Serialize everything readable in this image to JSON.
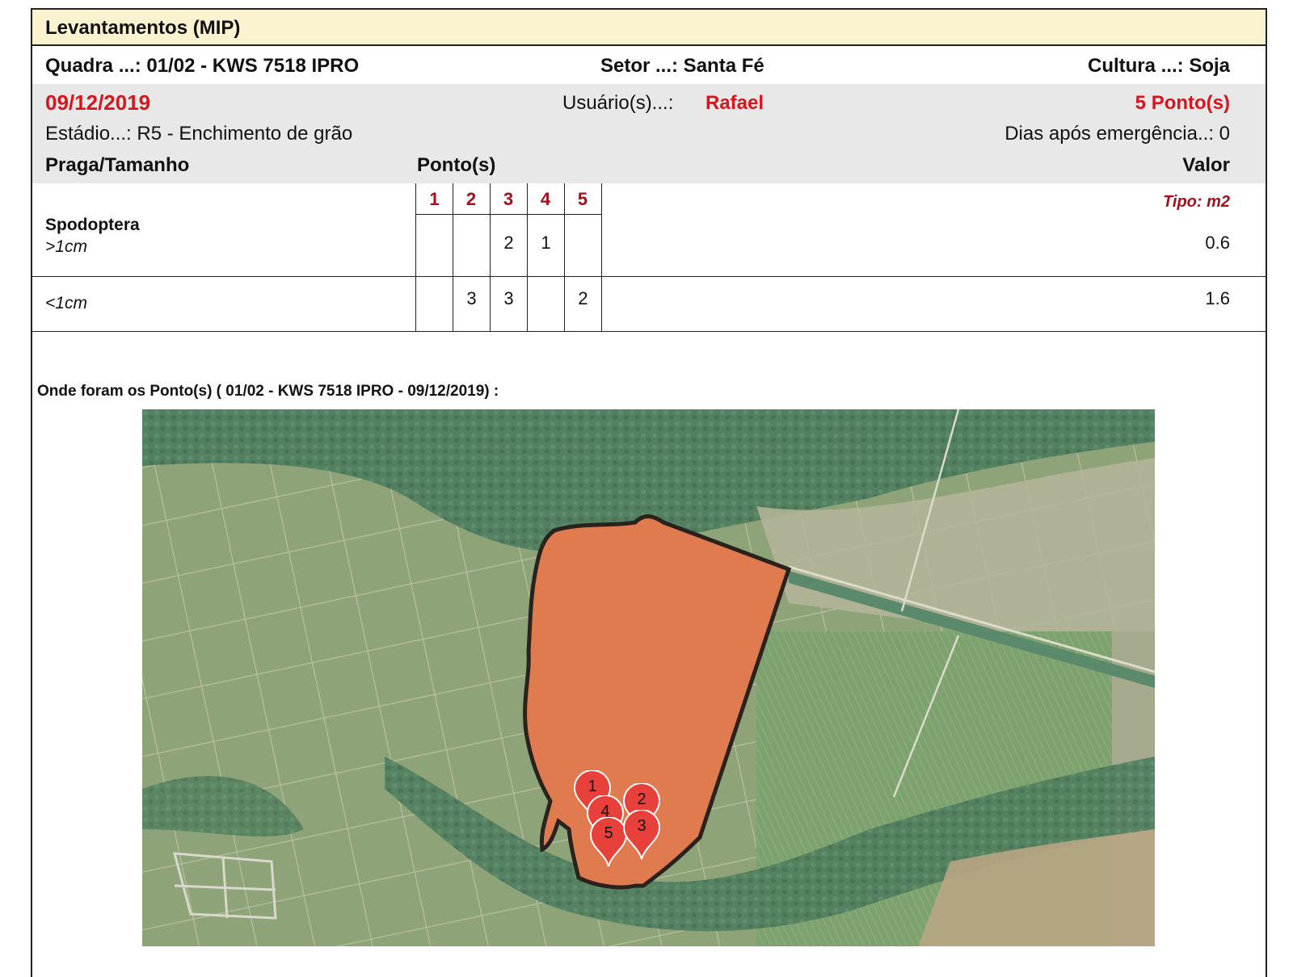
{
  "report": {
    "title": "Levantamentos (MIP)",
    "quadra": "Quadra ...: 01/02  - KWS 7518 IPRO",
    "setor": "Setor ...: Santa Fé",
    "cultura": "Cultura ...: Soja",
    "date": "09/12/2019",
    "usuarios_label": "Usuário(s)...:",
    "usuario": "Rafael",
    "pontos_count": "5 Ponto(s)",
    "estadio": "Estádio...: R5 - Enchimento de grão",
    "dias": "Dias após emergência..: 0"
  },
  "table": {
    "col_praga": "Praga/Tamanho",
    "col_pontos": "Ponto(s)",
    "col_valor": "Valor",
    "point_headers": [
      "1",
      "2",
      "3",
      "4",
      "5"
    ],
    "tipo": "Tipo: m2",
    "rows": [
      {
        "praga": "Spodoptera",
        "tamanho": ">1cm",
        "cells": [
          "",
          "",
          "2",
          "1",
          ""
        ],
        "valor": "0.6"
      },
      {
        "praga": "",
        "tamanho": "<1cm",
        "cells": [
          "",
          "3",
          "3",
          "",
          "2"
        ],
        "valor": "1.6"
      }
    ]
  },
  "map": {
    "caption": "Onde foram os Ponto(s) ( 01/02  - KWS 7518 IPRO - 09/12/2019) :",
    "markers": [
      "1",
      "2",
      "4",
      "5",
      "3"
    ],
    "colors": {
      "field_fill": "#e07a4f",
      "field_stroke": "#2a221c",
      "marker": "#e8403a"
    }
  }
}
